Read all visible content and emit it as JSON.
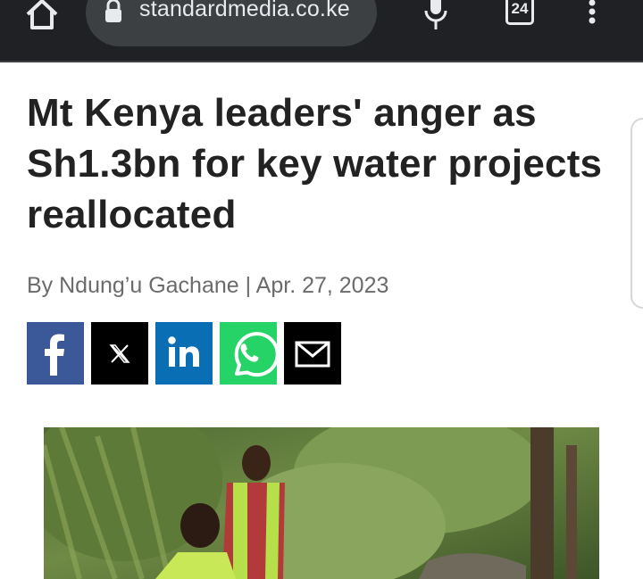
{
  "browser": {
    "url": "standardmedia.co.ke",
    "tab_count": "24",
    "icons": [
      "home-icon",
      "lock-icon",
      "mic-icon",
      "tabs-icon",
      "menu-icon"
    ]
  },
  "article": {
    "headline": "Mt Kenya leaders' anger as Sh1.3bn for key water projects reallocated",
    "byline": "By Ndung’u Gachane | Apr. 27, 2023"
  },
  "share": {
    "buttons": [
      {
        "network": "facebook",
        "icon": "facebook-icon",
        "color": "#3b5998"
      },
      {
        "network": "x",
        "icon": "x-icon",
        "color": "#000000"
      },
      {
        "network": "linkedin",
        "icon": "linkedin-icon",
        "color": "#0a6eb4"
      },
      {
        "network": "whatsapp",
        "icon": "whatsapp-icon",
        "color": "#25d366"
      },
      {
        "network": "email",
        "icon": "email-icon",
        "color": "#000000"
      }
    ]
  },
  "colors": {
    "toolbar": "#202124",
    "headline": "#222222",
    "byline": "#6b6b6b"
  }
}
